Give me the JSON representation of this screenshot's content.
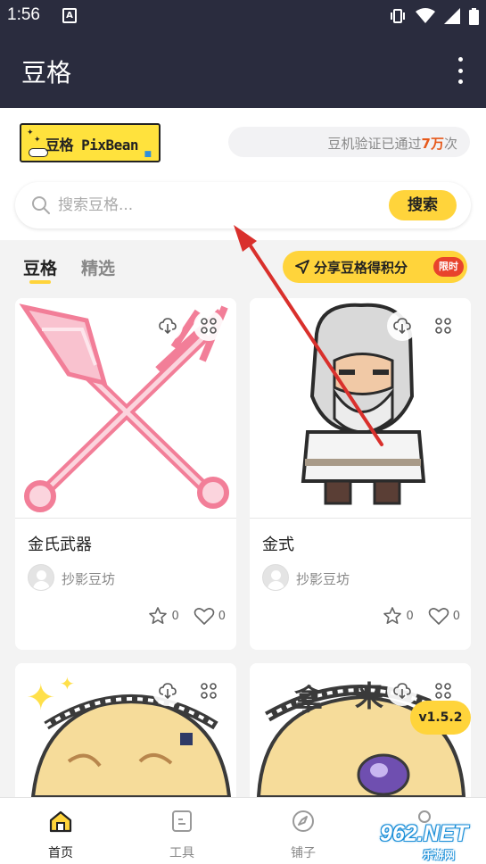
{
  "status_bar": {
    "time": "1:56",
    "notification_icon": "a-notification-icon",
    "icons": [
      "vibrate-icon",
      "wifi-icon",
      "signal-icon",
      "battery-icon"
    ]
  },
  "app_bar": {
    "title": "豆格",
    "menu_icon": "more-vertical-icon"
  },
  "logo": {
    "text": "豆格 PixBean"
  },
  "verify": {
    "prefix": "豆机验证已通过",
    "count": "7万",
    "suffix": "次"
  },
  "search": {
    "placeholder": "搜索豆格...",
    "button": "搜索"
  },
  "tabs": [
    {
      "label": "豆格",
      "active": true
    },
    {
      "label": "精选",
      "active": false
    }
  ],
  "share": {
    "label": "分享豆格得积分",
    "badge": "限时"
  },
  "cards": [
    {
      "title": "金氏武器",
      "author": "抄影豆坊",
      "stars": "0",
      "likes": "0"
    },
    {
      "title": "金式",
      "author": "抄影豆坊",
      "stars": "0",
      "likes": "0"
    },
    {
      "title": "",
      "author": "",
      "stars": "",
      "likes": ""
    },
    {
      "title": "",
      "author": "",
      "stars": "",
      "likes": ""
    }
  ],
  "version": "v1.5.2",
  "bottom_nav": [
    {
      "label": "首页",
      "icon": "home-icon",
      "active": true
    },
    {
      "label": "工具",
      "icon": "tool-icon",
      "active": false
    },
    {
      "label": "铺子",
      "icon": "compass-icon",
      "active": false
    },
    {
      "label": "",
      "icon": "profile-icon",
      "active": false
    }
  ],
  "watermark": {
    "text": "962.NET",
    "sub": "乐游网"
  },
  "colors": {
    "header": "#2a2c3e",
    "accent": "#ffd43b",
    "badge": "#e8432c",
    "highlight": "#e6591b"
  }
}
